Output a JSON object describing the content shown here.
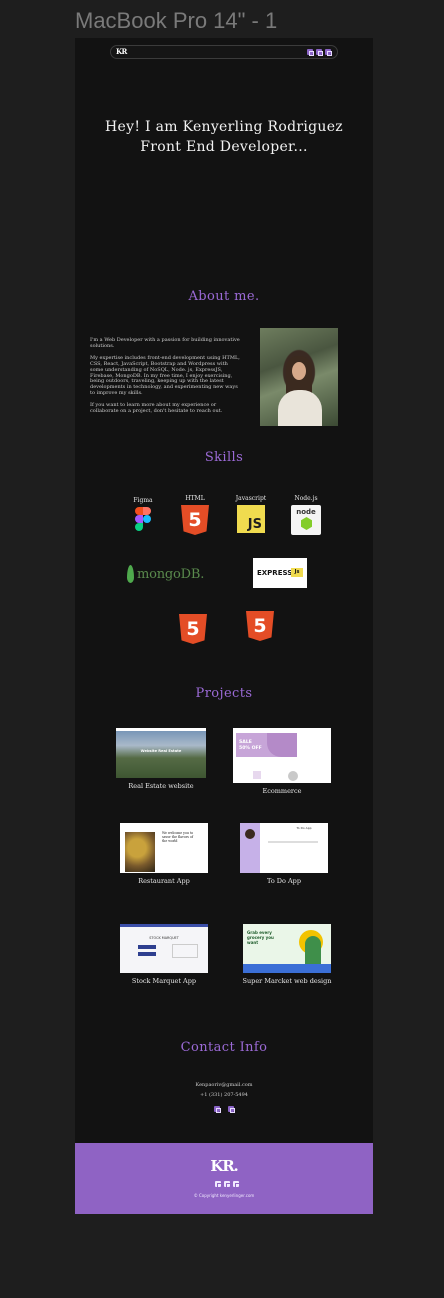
{
  "frame": {
    "label": "MacBook Pro 14\" - 1"
  },
  "nav": {
    "logo": "KR",
    "icons": [
      "linkedin-icon",
      "github-icon",
      "document-icon"
    ]
  },
  "hero": {
    "line1": "Hey! I am Kenyerling Rodriguez",
    "line2": "Front End Developer..."
  },
  "about": {
    "title": "About me.",
    "paragraphs": [
      "I'm a Web Developer with a passion for building innovative solutions.",
      "My expertise includes front-end development using HTML, CSS, React, JavaScript, Bootstrap and Wordpress with some understanding of NoSQL, Node. js, ExpressJS, Firebase, MongoDB. In my free time, I enjoy exercising, being outdoors, traveling, keeping up with the latest developments in technology, and experimenting new ways to improve my skills.",
      "If you want to learn more about my experience or collaborate on a project, don't hesitate to reach out."
    ]
  },
  "skills": {
    "title": "Skills",
    "items": [
      {
        "label": "Figma"
      },
      {
        "label": "HTML",
        "glyph": "5"
      },
      {
        "label": "Javascript",
        "glyph": "JS"
      },
      {
        "label": "Node.js",
        "glyph": "node"
      },
      {
        "label": "",
        "glyph": "mongoDB."
      },
      {
        "label": "",
        "glyph": "EXPRESS",
        "badge": "Js"
      },
      {
        "label": "",
        "glyph": "5"
      },
      {
        "label": "",
        "glyph": "5"
      }
    ]
  },
  "projects": {
    "title": "Projects",
    "items": [
      {
        "label": "Real Estate website",
        "thumb_text": "Website Real Estate"
      },
      {
        "label": "Ecommerce",
        "thumb_text": "SALE 50% OFF"
      },
      {
        "label": "Restaurant App",
        "thumb_text": "We welcome you to savor the flavors of the world"
      },
      {
        "label": "To Do App",
        "thumb_text": "To Do App"
      },
      {
        "label": "Stock Marquet App",
        "thumb_text": "STOCK MARQUET"
      },
      {
        "label": "Super Marcket web design",
        "thumb_text": "Grab every grocery you want"
      }
    ]
  },
  "contact": {
    "title": "Contact Info",
    "email": "Kenpaoriv@gmail.com",
    "phone": "+1 (331) 207-5494",
    "icons": [
      "email-icon",
      "linkedin-icon"
    ]
  },
  "footer": {
    "logo": "KR.",
    "icons": [
      "linkedin-icon",
      "github-icon",
      "document-icon"
    ],
    "copyright": "© Copyright kenyerlinger.com"
  },
  "colors": {
    "accent": "#8f63c4",
    "title": "#9b6ad6",
    "background": "#121212"
  }
}
